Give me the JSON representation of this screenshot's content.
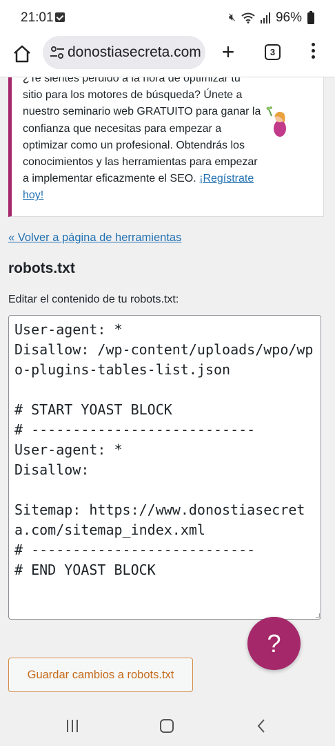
{
  "status_bar": {
    "time": "21:01",
    "battery": "96%",
    "icons": [
      "check-icon",
      "mute-icon",
      "wifi-icon",
      "signal-icon",
      "battery-icon"
    ]
  },
  "browser": {
    "url": "donostiasecreta.com",
    "tab_count": "3",
    "icons": [
      "home-icon",
      "site-settings-icon",
      "new-tab-icon",
      "tabs-icon",
      "more-menu-icon"
    ]
  },
  "notice": {
    "text": "¿Te sientes perdido a la hora de optimizar tu sitio para los motores de búsqueda? Únete a nuestro seminario web GRATUITO para ganar la confianza que necesitas para empezar a optimizar como un profesional. Obtendrás los conocimientos y las herramientas para empezar a implementar eficazmente el SEO. ",
    "link_text": "¡Regístrate hoy!",
    "accent_color": "#a4286a"
  },
  "content": {
    "back_link": "« Volver a página de herramientas",
    "title": "robots.txt",
    "field_label": "Editar el contenido de tu robots.txt:",
    "robots_content": "User-agent: *\nDisallow: /wp-content/uploads/wpo/wpo-plugins-tables-list.json\n\n# START YOAST BLOCK\n# ---------------------------\nUser-agent: *\nDisallow:\n\nSitemap: https://www.donostiasecreta.com/sitemap_index.xml\n# ---------------------------\n# END YOAST BLOCK",
    "save_button": "Guardar cambios a robots.txt",
    "help_button": "?"
  },
  "colors": {
    "link": "#2271b1",
    "button_border": "#d58b45",
    "help_fab": "#a4286a"
  },
  "nav_icons": [
    "recent-apps-icon",
    "home-nav-icon",
    "back-nav-icon"
  ]
}
